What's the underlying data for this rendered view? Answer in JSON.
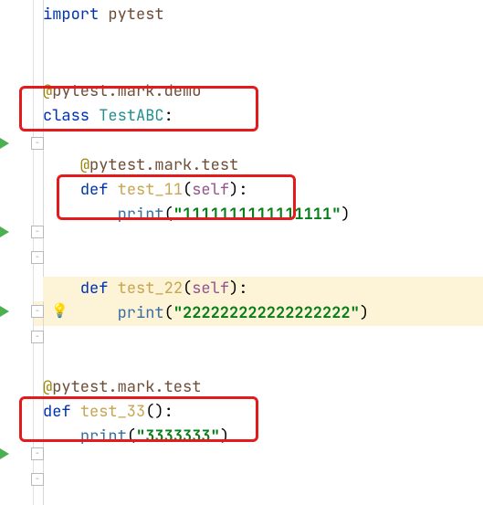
{
  "code": {
    "import_kw": "import",
    "import_mod": "pytest",
    "dec1_at": "@",
    "dec1_text": "pytest.mark.demo",
    "class_kw": "class",
    "class_name": "TestABC",
    "colon": ":",
    "dec2_at": "@",
    "dec2_text": "pytest.mark.test",
    "def_kw": "def",
    "fn1": "test_11",
    "fn2": "test_22",
    "fn3": "test_33",
    "self": "self",
    "print": "print",
    "lp": "(",
    "rp": ")",
    "str1": "\"1111111111111111\"",
    "str2": "\"222222222222222222\"",
    "dec3_at": "@",
    "dec3_text": "pytest.mark.test",
    "str3": "\"3333333\""
  },
  "icons": {
    "bulb": "💡"
  },
  "annotations": {
    "box1": true,
    "box2": true,
    "box3": true
  }
}
